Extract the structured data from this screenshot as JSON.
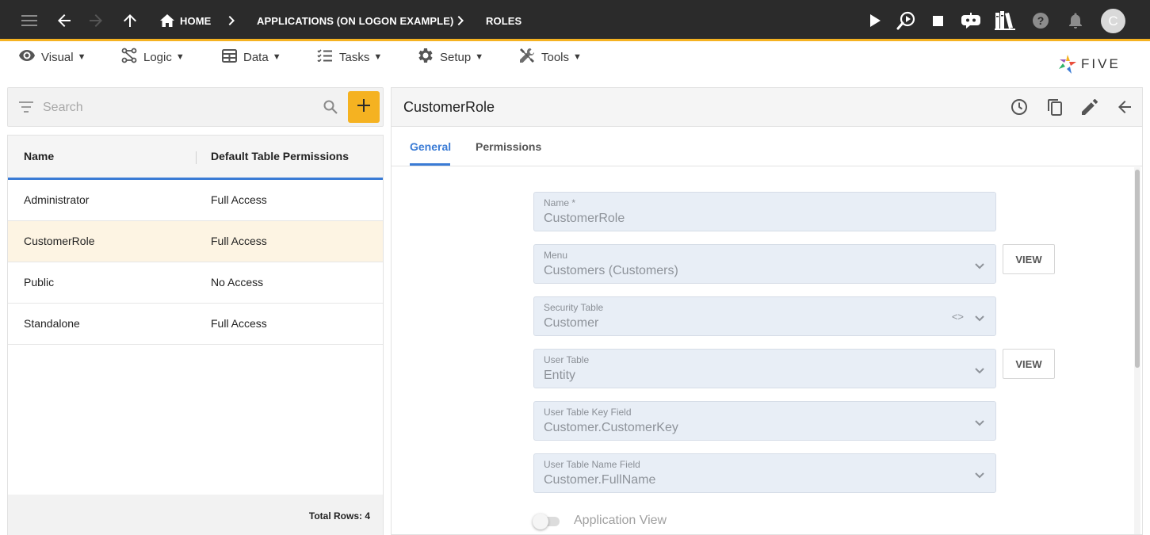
{
  "topbar": {
    "breadcrumbs": [
      {
        "label": "HOME"
      },
      {
        "label": "APPLICATIONS (ON LOGON EXAMPLE)"
      },
      {
        "label": "ROLES"
      }
    ],
    "avatar_initial": "C",
    "icons": [
      "menu-icon",
      "back-arrow-icon",
      "forward-arrow-icon",
      "up-arrow-icon",
      "home-icon",
      "play-icon",
      "debug-search-icon",
      "stop-icon",
      "chat-bot-icon",
      "library-icon",
      "help-icon",
      "bell-icon"
    ]
  },
  "menubar": {
    "items": [
      {
        "label": "Visual",
        "icon": "eye-icon"
      },
      {
        "label": "Logic",
        "icon": "logic-icon"
      },
      {
        "label": "Data",
        "icon": "table-icon"
      },
      {
        "label": "Tasks",
        "icon": "tasks-icon"
      },
      {
        "label": "Setup",
        "icon": "gear-icon"
      },
      {
        "label": "Tools",
        "icon": "tools-icon"
      }
    ],
    "caret": "▼",
    "logo_text": "FIVE"
  },
  "list": {
    "search_placeholder": "Search",
    "add_label": "+",
    "columns": [
      "Name",
      "Default Table Permissions"
    ],
    "rows": [
      {
        "name": "Administrator",
        "permissions": "Full Access"
      },
      {
        "name": "CustomerRole",
        "permissions": "Full Access"
      },
      {
        "name": "Public",
        "permissions": "No Access"
      },
      {
        "name": "Standalone",
        "permissions": "Full Access"
      }
    ],
    "selected_row": 1,
    "footer": "Total Rows: 4"
  },
  "form": {
    "title": "CustomerRole",
    "tabs": [
      {
        "label": "General"
      },
      {
        "label": "Permissions"
      }
    ],
    "fields": [
      {
        "label": "Name *",
        "value": "CustomerRole"
      },
      {
        "label": "Menu",
        "value": "Customers (Customers)"
      },
      {
        "label": "Security Table",
        "value": "Customer",
        "code_icon": "<>"
      },
      {
        "label": "User Table",
        "value": "Entity"
      },
      {
        "label": "User Table Key Field",
        "value": "Customer.CustomerKey"
      },
      {
        "label": "User Table Name Field",
        "value": "Customer.FullName"
      }
    ],
    "view_label": "VIEW",
    "toggle_label": "Application View",
    "toggle_on": false
  },
  "colors": {
    "accent": "#f5b221",
    "primary": "#3a7bd5",
    "topbar_bg": "#2b2b2b",
    "selected_row_bg": "#fdf4e3",
    "field_bg": "#e8eef6"
  }
}
